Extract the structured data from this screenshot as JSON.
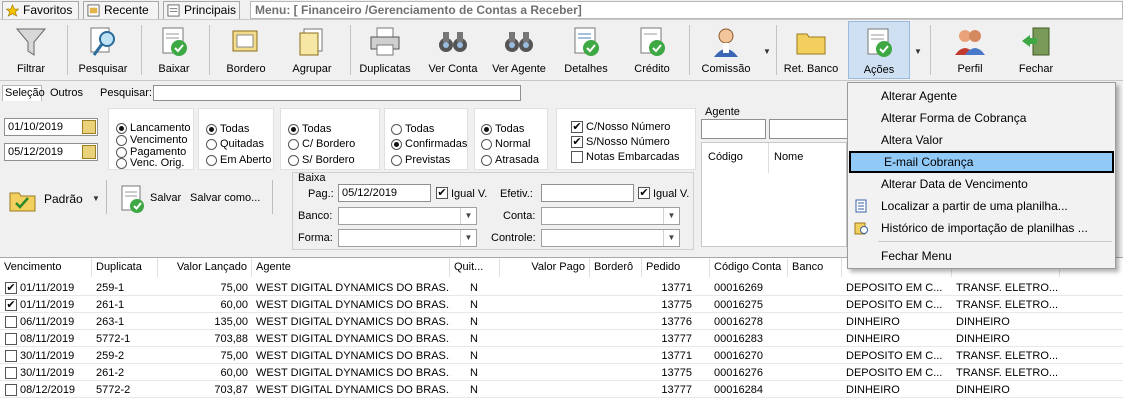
{
  "top_tabs": [
    {
      "label": "Favoritos",
      "icon": "star-icon"
    },
    {
      "label": "Recente",
      "icon": "recent-icon"
    },
    {
      "label": "Principais",
      "icon": "main-icon"
    }
  ],
  "menu_path": "Menu: [ Financeiro /Gerenciamento de Contas a Receber]",
  "toolbar": {
    "filtrar": "Filtrar",
    "pesquisar": "Pesquisar",
    "baixar": "Baixar",
    "bordero": "Bordero",
    "agrupar": "Agrupar",
    "duplicatas": "Duplicatas",
    "ver_conta": "Ver Conta",
    "ver_agente": "Ver Agente",
    "detalhes": "Detalhes",
    "credito": "Crédito",
    "comissao": "Comissão",
    "ret_banco": "Ret. Banco",
    "acoes": "Ações",
    "perfil": "Perfil",
    "fechar": "Fechar"
  },
  "filter_tabs": {
    "selecao": "Seleção",
    "outros": "Outros"
  },
  "search": {
    "label": "Pesquisar:",
    "value": ""
  },
  "dates": {
    "from": "01/10/2019",
    "to": "05/12/2019"
  },
  "date_type": {
    "options": [
      "Lancamento",
      "Vencimento",
      "Pagamento",
      "Venc. Orig."
    ],
    "selected": 0
  },
  "status_group": {
    "options": [
      "Todas",
      "Quitadas",
      "Em Aberto"
    ],
    "selected": 0
  },
  "bordero_group": {
    "options": [
      "Todas",
      "C/ Bordero",
      "S/ Bordero"
    ],
    "selected": 0
  },
  "confirm_group": {
    "options": [
      "Todas",
      "Confirmadas",
      "Previstas"
    ],
    "selected": 1
  },
  "late_group": {
    "options": [
      "Todas",
      "Normal",
      "Atrasada"
    ],
    "selected": 0
  },
  "checks": [
    {
      "label": "C/Nosso Número",
      "checked": true
    },
    {
      "label": "S/Nosso Número",
      "checked": true
    },
    {
      "label": "Notas Embarcadas",
      "checked": false
    }
  ],
  "agente": {
    "title": "Agente",
    "col_codigo": "Código",
    "col_nome": "Nome"
  },
  "profile": {
    "padrao": "Padrão",
    "salvar": "Salvar",
    "salvar_como": "Salvar como..."
  },
  "baixa": {
    "title": "Baixa",
    "pag_label": "Pag.:",
    "pag_value": "05/12/2019",
    "igual_v": "Igual V.",
    "efetiv_label": "Efetiv.:",
    "efetiv_value": "",
    "banco_label": "Banco:",
    "conta_label": "Conta:",
    "forma_label": "Forma:",
    "controle_label": "Controle:"
  },
  "table": {
    "headers": [
      "Vencimento",
      "Duplicata",
      "Valor Lançado",
      "Agente",
      "Quit...",
      "Valor Pago",
      "Borderô",
      "Pedido",
      "Código Conta",
      "Banco",
      "",
      ""
    ],
    "rows": [
      {
        "checked": true,
        "venc": "01/11/2019",
        "dup": "259-1",
        "valor": "75,00",
        "agente": "WEST DIGITAL DYNAMICS DO BRAS...",
        "quit": "N",
        "pago": "",
        "bordero": "",
        "pedido": "13771",
        "conta": "00016269",
        "banco": "",
        "forma": "DEPOSITO EM C...",
        "tipo": "TRANSF. ELETRO..."
      },
      {
        "checked": true,
        "venc": "01/11/2019",
        "dup": "261-1",
        "valor": "60,00",
        "agente": "WEST DIGITAL DYNAMICS DO BRAS...",
        "quit": "N",
        "pago": "",
        "bordero": "",
        "pedido": "13775",
        "conta": "00016275",
        "banco": "",
        "forma": "DEPOSITO EM C...",
        "tipo": "TRANSF. ELETRO..."
      },
      {
        "checked": false,
        "venc": "06/11/2019",
        "dup": "263-1",
        "valor": "135,00",
        "agente": "WEST DIGITAL DYNAMICS DO BRAS...",
        "quit": "N",
        "pago": "",
        "bordero": "",
        "pedido": "13776",
        "conta": "00016278",
        "banco": "",
        "forma": "DINHEIRO",
        "tipo": "DINHEIRO"
      },
      {
        "checked": false,
        "venc": "08/11/2019",
        "dup": "5772-1",
        "valor": "703,88",
        "agente": "WEST DIGITAL DYNAMICS DO BRAS...",
        "quit": "N",
        "pago": "",
        "bordero": "",
        "pedido": "13777",
        "conta": "00016283",
        "banco": "",
        "forma": "DINHEIRO",
        "tipo": "DINHEIRO"
      },
      {
        "checked": false,
        "venc": "30/11/2019",
        "dup": "259-2",
        "valor": "75,00",
        "agente": "WEST DIGITAL DYNAMICS DO BRAS...",
        "quit": "N",
        "pago": "",
        "bordero": "",
        "pedido": "13771",
        "conta": "00016270",
        "banco": "",
        "forma": "DEPOSITO EM C...",
        "tipo": "TRANSF. ELETRO..."
      },
      {
        "checked": false,
        "venc": "30/11/2019",
        "dup": "261-2",
        "valor": "60,00",
        "agente": "WEST DIGITAL DYNAMICS DO BRAS...",
        "quit": "N",
        "pago": "",
        "bordero": "",
        "pedido": "13775",
        "conta": "00016276",
        "banco": "",
        "forma": "DEPOSITO EM C...",
        "tipo": "TRANSF. ELETRO..."
      },
      {
        "checked": false,
        "venc": "08/12/2019",
        "dup": "5772-2",
        "valor": "703,87",
        "agente": "WEST DIGITAL DYNAMICS DO BRAS...",
        "quit": "N",
        "pago": "",
        "bordero": "",
        "pedido": "13777",
        "conta": "00016284",
        "banco": "",
        "forma": "DINHEIRO",
        "tipo": "DINHEIRO"
      }
    ]
  },
  "acoes_menu": [
    {
      "label": "Alterar Agente",
      "icon": ""
    },
    {
      "label": "Alterar Forma de Cobrança",
      "icon": ""
    },
    {
      "label": "Altera Valor",
      "icon": ""
    },
    {
      "label": "E-mail Cobrança",
      "icon": "",
      "highlighted": true
    },
    {
      "label": "Alterar Data de Vencimento",
      "icon": ""
    },
    {
      "label": "Localizar a partir de uma planilha...",
      "icon": "spreadsheet-icon"
    },
    {
      "label": "Histórico de importação de planilhas ...",
      "icon": "history-icon"
    },
    {
      "label": "Fechar Menu",
      "icon": ""
    }
  ],
  "colors": {
    "highlight": "#91c9f7",
    "active_button": "#cfe0f3"
  }
}
